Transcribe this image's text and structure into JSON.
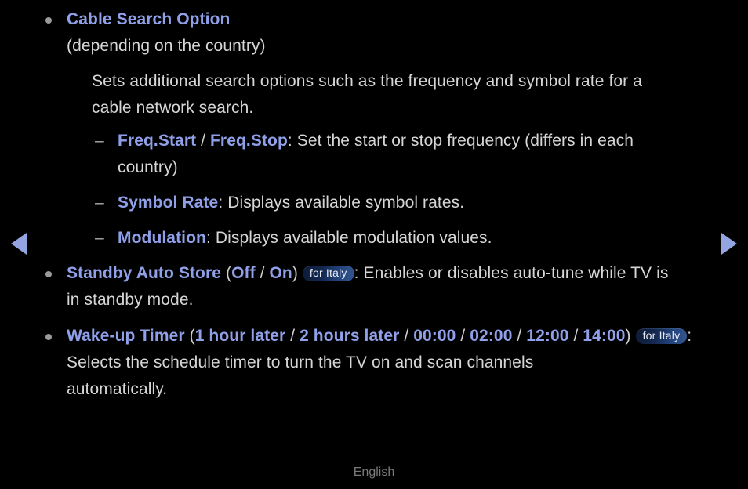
{
  "theme": {
    "background": "#000000",
    "body_text": "#d6d6d6",
    "keyword_blue": "#8fa0e8",
    "arrow_blue": "#93a4e0",
    "bullet_gray": "#9a9a9a",
    "footer_gray": "#7a7a7a",
    "badge_gradient_from": "#0e1b38",
    "badge_gradient_to": "#34578f",
    "badge_text": "#e8eaf2"
  },
  "nav": {
    "prev_icon": "triangle-left-icon",
    "next_icon": "triangle-right-icon"
  },
  "footer": {
    "language": "English"
  },
  "content": {
    "cable_search": {
      "bullet_glyph": "•",
      "title": "Cable Search Option",
      "subtitle": "(depending on the country)",
      "description_line_1": "Sets additional search options such as the frequency and symbol rate for a",
      "description_line_2": "cable network search.",
      "sub_items": [
        {
          "dash_glyph": "–",
          "keyword_1": "Freq.Start",
          "separator": " / ",
          "keyword_2": "Freq.Stop",
          "colon": ": ",
          "text_line_1": "Set the start or stop frequency (differs in each",
          "text_line_2": "country)"
        },
        {
          "dash_glyph": "–",
          "keyword_1": "Symbol Rate",
          "colon": ": ",
          "text_line_1": "Displays available symbol rates."
        },
        {
          "dash_glyph": "–",
          "keyword_1": "Modulation",
          "colon": ": ",
          "text_line_1": "Displays available modulation values."
        }
      ]
    },
    "standby_auto_store": {
      "bullet_glyph": "•",
      "title": "Standby Auto Store",
      "paren_open": " (",
      "option_1": "Off",
      "option_sep": " / ",
      "option_2": "On",
      "paren_close": ") ",
      "badge": "for Italy",
      "colon": ": ",
      "text_line_1": "Enables or disables auto-tune while TV is",
      "text_line_2": "in standby mode."
    },
    "wake_up_timer": {
      "bullet_glyph": "•",
      "title": "Wake-up Timer",
      "paren_open": " (",
      "options": [
        "1 hour later",
        "2 hours later",
        "00:00",
        "02:00",
        "12:00",
        "14:00"
      ],
      "option_sep": " / ",
      "paren_close": ") ",
      "badge": "for Italy",
      "colon": ": ",
      "text_line_1": "Selects the schedule timer to turn the TV on and scan channels",
      "text_line_2": "automatically."
    }
  }
}
